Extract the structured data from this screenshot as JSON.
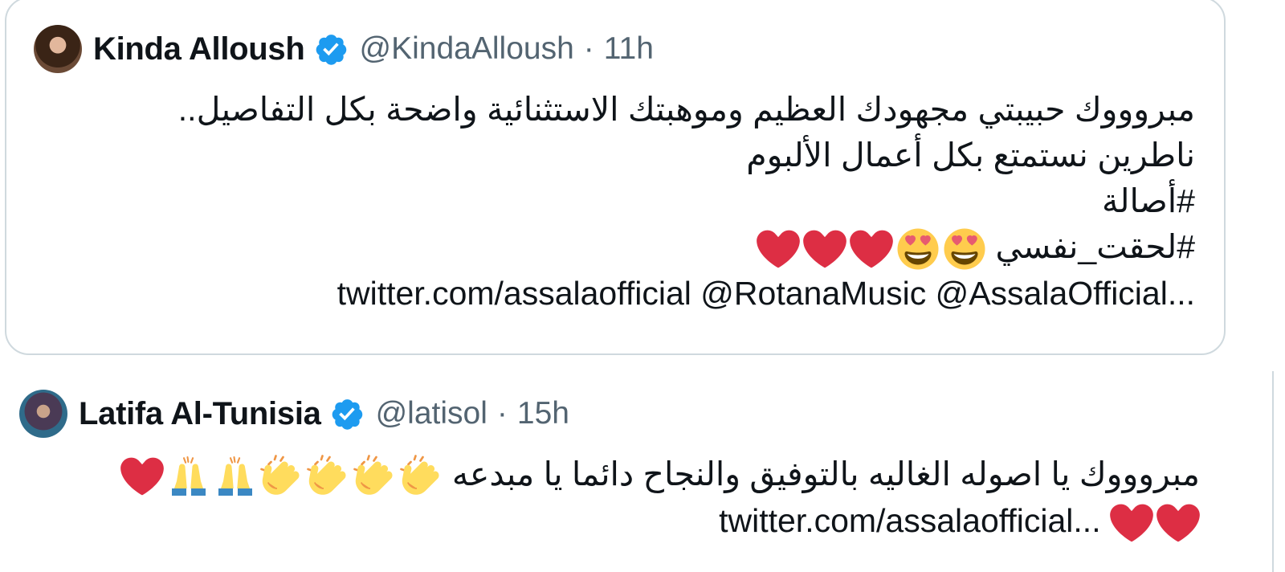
{
  "tweets": [
    {
      "display_name": "Kinda Alloush",
      "handle": "@KindaAlloush",
      "separator": "·",
      "time": "11h",
      "lines": [
        "مبروووك حبيبتي مجهودك العظيم وموهبتك الاستثنائية واضحة بكل التفاصيل..",
        "ناطرين نستمتع بكل أعمال الألبوم",
        "#أصالة",
        "#لحقت_نفسي"
      ],
      "last_line": "twitter.com/assalaofficial @RotanaMusic @AssalaOfficial...",
      "emojis": [
        "heart-eyes-icon",
        "heart-eyes-icon",
        "red-heart-icon",
        "red-heart-icon",
        "red-heart-icon"
      ]
    },
    {
      "display_name": "Latifa Al-Tunisia",
      "handle": "@latisol",
      "separator": "·",
      "time": "15h",
      "line1": "مبروووك يا اصوله الغاليه بالتوفيق والنجاح دائما يا مبدعه",
      "last_line": "twitter.com/assalaofficial...",
      "emojis": [
        "clapping-hands-icon",
        "clapping-hands-icon",
        "clapping-hands-icon",
        "clapping-hands-icon",
        "folded-hands-icon",
        "folded-hands-icon",
        "red-heart-icon"
      ],
      "emojis_end": [
        "red-heart-icon",
        "red-heart-icon"
      ]
    }
  ],
  "colors": {
    "text": "#0f1419",
    "secondary": "#536471",
    "verified_blue": "#1d9bf0",
    "border": "#cfd9de",
    "heart_red": "#e0243b",
    "emoji_yellow": "#ffcc4d"
  }
}
